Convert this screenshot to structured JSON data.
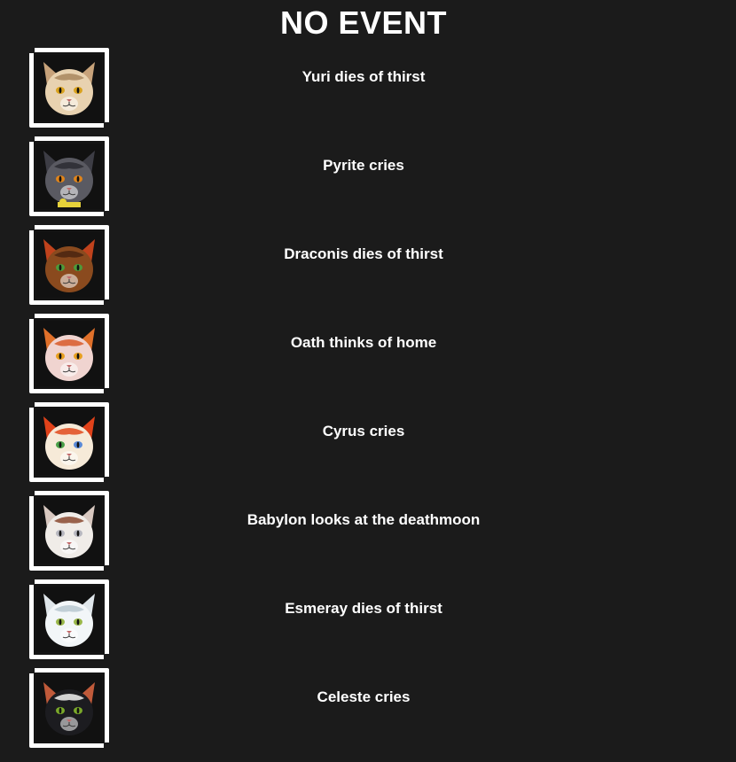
{
  "header": {
    "title": "NO EVENT"
  },
  "events": [
    {
      "text": "Yuri dies of thirst",
      "cat": {
        "fur": "#e8d2b0",
        "dark": "#a8875e",
        "eye": "#d9a21e",
        "ear": "#c7a27a"
      }
    },
    {
      "text": "Pyrite cries",
      "cat": {
        "fur": "#5a5a62",
        "dark": "#2c2c33",
        "eye": "#e0841a",
        "ear": "#3d3d45",
        "collar": "#e6d23a"
      }
    },
    {
      "text": "Draconis dies of thirst",
      "cat": {
        "fur": "#8a4a1e",
        "dark": "#4a2410",
        "eye": "#4d9a3a",
        "ear": "#c0421c"
      }
    },
    {
      "text": "Oath thinks of home",
      "cat": {
        "fur": "#f0d4d0",
        "dark": "#d85a2a",
        "eye": "#e8a020",
        "ear": "#e0702a"
      }
    },
    {
      "text": "Cyrus cries",
      "cat": {
        "fur": "#f6ead8",
        "dark": "#e04a1c",
        "eye": "#4aa048",
        "eye2": "#5a8ad8",
        "ear": "#e0421a"
      }
    },
    {
      "text": "Babylon looks at the deathmoon",
      "cat": {
        "fur": "#f0ece8",
        "dark": "#8a4a30",
        "eye": "#b8b8c0",
        "ear": "#d8c8c0"
      }
    },
    {
      "text": "Esmeray dies of thirst",
      "cat": {
        "fur": "#f2f6f8",
        "dark": "#b8c8d0",
        "eye": "#9ab84a",
        "ear": "#dfe6ea"
      }
    },
    {
      "text": "Celeste cries",
      "cat": {
        "fur": "#1c1c20",
        "dark": "#f2f2f2",
        "eye": "#7aa82a",
        "ear": "#c05a3a"
      }
    }
  ]
}
